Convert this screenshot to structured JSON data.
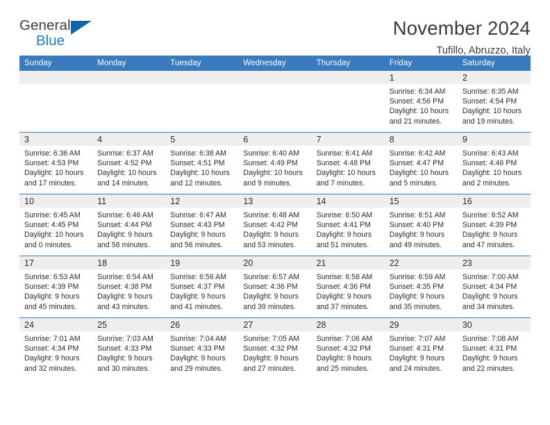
{
  "brand": {
    "name_part1": "General",
    "name_part2": "Blue",
    "triangle_icon": "triangle-icon",
    "color_dark": "#3c3c3c",
    "color_blue": "#1e7bc4"
  },
  "header": {
    "title": "November 2024",
    "subtitle": "Tufillo, Abruzzo, Italy"
  },
  "theme": {
    "header_bar": "#3a7bbf",
    "daynum_band": "#eeeeee",
    "text": "#2b2b2b"
  },
  "weekdays": [
    "Sunday",
    "Monday",
    "Tuesday",
    "Wednesday",
    "Thursday",
    "Friday",
    "Saturday"
  ],
  "labels": {
    "sunrise_prefix": "Sunrise:",
    "sunset_prefix": "Sunset:",
    "daylight_prefix": "Daylight:"
  },
  "weeks": [
    [
      {
        "empty": true
      },
      {
        "empty": true
      },
      {
        "empty": true
      },
      {
        "empty": true
      },
      {
        "empty": true
      },
      {
        "empty": false,
        "day": "1",
        "sunrise": "Sunrise: 6:34 AM",
        "sunset": "Sunset: 4:56 PM",
        "daylight": "Daylight: 10 hours and 21 minutes."
      },
      {
        "empty": false,
        "day": "2",
        "sunrise": "Sunrise: 6:35 AM",
        "sunset": "Sunset: 4:54 PM",
        "daylight": "Daylight: 10 hours and 19 minutes."
      }
    ],
    [
      {
        "empty": false,
        "day": "3",
        "sunrise": "Sunrise: 6:36 AM",
        "sunset": "Sunset: 4:53 PM",
        "daylight": "Daylight: 10 hours and 17 minutes."
      },
      {
        "empty": false,
        "day": "4",
        "sunrise": "Sunrise: 6:37 AM",
        "sunset": "Sunset: 4:52 PM",
        "daylight": "Daylight: 10 hours and 14 minutes."
      },
      {
        "empty": false,
        "day": "5",
        "sunrise": "Sunrise: 6:38 AM",
        "sunset": "Sunset: 4:51 PM",
        "daylight": "Daylight: 10 hours and 12 minutes."
      },
      {
        "empty": false,
        "day": "6",
        "sunrise": "Sunrise: 6:40 AM",
        "sunset": "Sunset: 4:49 PM",
        "daylight": "Daylight: 10 hours and 9 minutes."
      },
      {
        "empty": false,
        "day": "7",
        "sunrise": "Sunrise: 6:41 AM",
        "sunset": "Sunset: 4:48 PM",
        "daylight": "Daylight: 10 hours and 7 minutes."
      },
      {
        "empty": false,
        "day": "8",
        "sunrise": "Sunrise: 6:42 AM",
        "sunset": "Sunset: 4:47 PM",
        "daylight": "Daylight: 10 hours and 5 minutes."
      },
      {
        "empty": false,
        "day": "9",
        "sunrise": "Sunrise: 6:43 AM",
        "sunset": "Sunset: 4:46 PM",
        "daylight": "Daylight: 10 hours and 2 minutes."
      }
    ],
    [
      {
        "empty": false,
        "day": "10",
        "sunrise": "Sunrise: 6:45 AM",
        "sunset": "Sunset: 4:45 PM",
        "daylight": "Daylight: 10 hours and 0 minutes."
      },
      {
        "empty": false,
        "day": "11",
        "sunrise": "Sunrise: 6:46 AM",
        "sunset": "Sunset: 4:44 PM",
        "daylight": "Daylight: 9 hours and 58 minutes."
      },
      {
        "empty": false,
        "day": "12",
        "sunrise": "Sunrise: 6:47 AM",
        "sunset": "Sunset: 4:43 PM",
        "daylight": "Daylight: 9 hours and 56 minutes."
      },
      {
        "empty": false,
        "day": "13",
        "sunrise": "Sunrise: 6:48 AM",
        "sunset": "Sunset: 4:42 PM",
        "daylight": "Daylight: 9 hours and 53 minutes."
      },
      {
        "empty": false,
        "day": "14",
        "sunrise": "Sunrise: 6:50 AM",
        "sunset": "Sunset: 4:41 PM",
        "daylight": "Daylight: 9 hours and 51 minutes."
      },
      {
        "empty": false,
        "day": "15",
        "sunrise": "Sunrise: 6:51 AM",
        "sunset": "Sunset: 4:40 PM",
        "daylight": "Daylight: 9 hours and 49 minutes."
      },
      {
        "empty": false,
        "day": "16",
        "sunrise": "Sunrise: 6:52 AM",
        "sunset": "Sunset: 4:39 PM",
        "daylight": "Daylight: 9 hours and 47 minutes."
      }
    ],
    [
      {
        "empty": false,
        "day": "17",
        "sunrise": "Sunrise: 6:53 AM",
        "sunset": "Sunset: 4:39 PM",
        "daylight": "Daylight: 9 hours and 45 minutes."
      },
      {
        "empty": false,
        "day": "18",
        "sunrise": "Sunrise: 6:54 AM",
        "sunset": "Sunset: 4:38 PM",
        "daylight": "Daylight: 9 hours and 43 minutes."
      },
      {
        "empty": false,
        "day": "19",
        "sunrise": "Sunrise: 6:56 AM",
        "sunset": "Sunset: 4:37 PM",
        "daylight": "Daylight: 9 hours and 41 minutes."
      },
      {
        "empty": false,
        "day": "20",
        "sunrise": "Sunrise: 6:57 AM",
        "sunset": "Sunset: 4:36 PM",
        "daylight": "Daylight: 9 hours and 39 minutes."
      },
      {
        "empty": false,
        "day": "21",
        "sunrise": "Sunrise: 6:58 AM",
        "sunset": "Sunset: 4:36 PM",
        "daylight": "Daylight: 9 hours and 37 minutes."
      },
      {
        "empty": false,
        "day": "22",
        "sunrise": "Sunrise: 6:59 AM",
        "sunset": "Sunset: 4:35 PM",
        "daylight": "Daylight: 9 hours and 35 minutes."
      },
      {
        "empty": false,
        "day": "23",
        "sunrise": "Sunrise: 7:00 AM",
        "sunset": "Sunset: 4:34 PM",
        "daylight": "Daylight: 9 hours and 34 minutes."
      }
    ],
    [
      {
        "empty": false,
        "day": "24",
        "sunrise": "Sunrise: 7:01 AM",
        "sunset": "Sunset: 4:34 PM",
        "daylight": "Daylight: 9 hours and 32 minutes."
      },
      {
        "empty": false,
        "day": "25",
        "sunrise": "Sunrise: 7:03 AM",
        "sunset": "Sunset: 4:33 PM",
        "daylight": "Daylight: 9 hours and 30 minutes."
      },
      {
        "empty": false,
        "day": "26",
        "sunrise": "Sunrise: 7:04 AM",
        "sunset": "Sunset: 4:33 PM",
        "daylight": "Daylight: 9 hours and 29 minutes."
      },
      {
        "empty": false,
        "day": "27",
        "sunrise": "Sunrise: 7:05 AM",
        "sunset": "Sunset: 4:32 PM",
        "daylight": "Daylight: 9 hours and 27 minutes."
      },
      {
        "empty": false,
        "day": "28",
        "sunrise": "Sunrise: 7:06 AM",
        "sunset": "Sunset: 4:32 PM",
        "daylight": "Daylight: 9 hours and 25 minutes."
      },
      {
        "empty": false,
        "day": "29",
        "sunrise": "Sunrise: 7:07 AM",
        "sunset": "Sunset: 4:31 PM",
        "daylight": "Daylight: 9 hours and 24 minutes."
      },
      {
        "empty": false,
        "day": "30",
        "sunrise": "Sunrise: 7:08 AM",
        "sunset": "Sunset: 4:31 PM",
        "daylight": "Daylight: 9 hours and 22 minutes."
      }
    ]
  ]
}
